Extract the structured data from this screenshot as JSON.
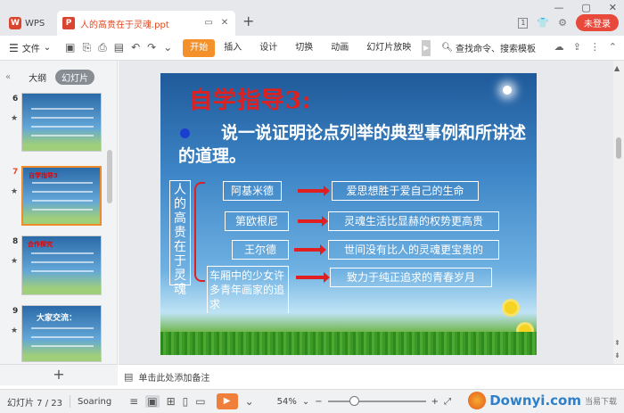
{
  "app": {
    "wps_label": "WPS",
    "doc_title": "人的高贵在于灵魂.ppt",
    "page_badge": "1",
    "login_label": "未登录"
  },
  "menubar": {
    "file_label": "文件",
    "items": [
      "开始",
      "插入",
      "设计",
      "切换",
      "动画",
      "幻灯片放映"
    ],
    "active_item": "开始",
    "search_label": "查找命令、搜索模板"
  },
  "left_panel": {
    "tabs": [
      "大纲",
      "幻灯片"
    ],
    "selected_tab": "幻灯片",
    "thumbnails": [
      {
        "number": "6",
        "title": ""
      },
      {
        "number": "7",
        "title": "自学指导3"
      },
      {
        "number": "8",
        "title": "合作探究"
      },
      {
        "number": "9",
        "title": "大家交流："
      }
    ],
    "selected_number": "7"
  },
  "slide": {
    "title": "自学指导3:",
    "body": "说一说证明论点列举的典型事例和所讲述的道理。",
    "vertical_label": "人的高贵在于灵魂",
    "rows": [
      {
        "left": "阿基米德",
        "right": "爱思想胜于爱自己的生命"
      },
      {
        "left": "第欧根尼",
        "right": "灵魂生活比显赫的权势更高贵"
      },
      {
        "left": "王尔德",
        "right": "世间没有比人的灵魂更宝贵的"
      },
      {
        "left": "车厢中的少女许多青年画家的追求",
        "right": "致力于纯正追求的青春岁月"
      }
    ]
  },
  "notes": {
    "placeholder": "单击此处添加备注"
  },
  "statusbar": {
    "slide_label": "幻灯片 7 / 23",
    "theme": "Soaring",
    "zoom": "54%",
    "watermark_en": "Downyi",
    "watermark_dot": ".com",
    "watermark_cn": "当易下载"
  },
  "colors": {
    "accent": "#f4912b",
    "doc_tab_text": "#e0471f",
    "login": "#e8493a",
    "slide_title": "#e01f1f"
  }
}
